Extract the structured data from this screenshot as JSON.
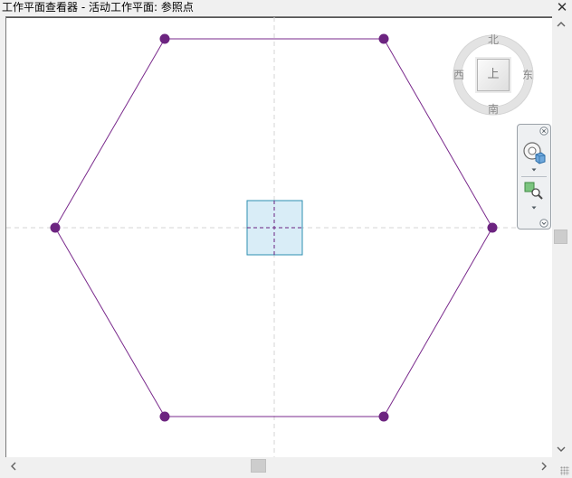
{
  "window": {
    "title": "工作平面查看器 - 活动工作平面: 参照点",
    "close_glyph": "✕"
  },
  "view_cube": {
    "face_label": "上",
    "north": "北",
    "south": "南",
    "east": "东",
    "west": "西"
  },
  "navigation_bar": {
    "tools": [
      "steering-wheel",
      "zoom-region"
    ]
  },
  "drawing": {
    "shape": "hexagon",
    "vertex_count": 6,
    "line_color": "#7a2a8c",
    "vertex_color": "#6c2480",
    "reference_plane_fill": "#d9edf7",
    "reference_plane_border": "#2d8fb0",
    "guide_color": "#d0d0d0"
  },
  "scrollbars": {
    "vertical": true,
    "horizontal": true
  }
}
